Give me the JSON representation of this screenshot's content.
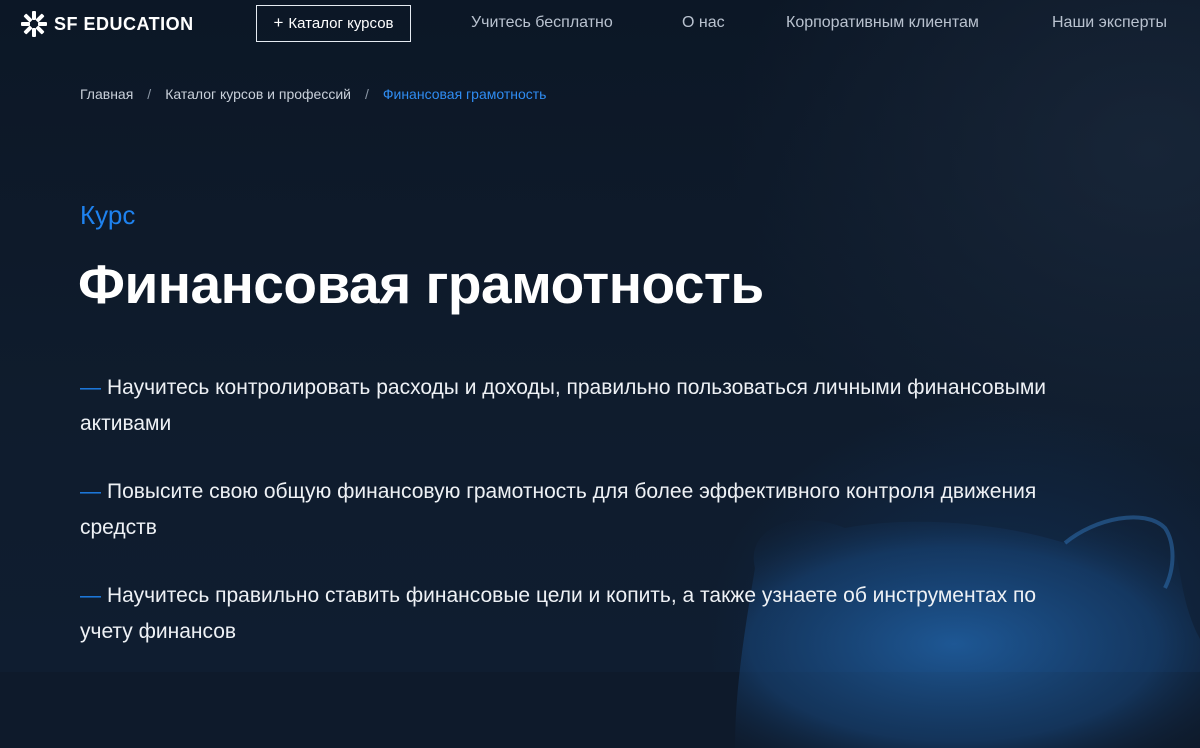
{
  "brand": {
    "name": "SF EDUCATION",
    "logo_icon": "snowflake-icon"
  },
  "header": {
    "catalog_button": "Каталог курсов",
    "nav": [
      "Учитесь бесплатно",
      "О нас",
      "Корпоративным клиентам",
      "Наши эксперты"
    ]
  },
  "breadcrumb": {
    "items": [
      "Главная",
      "Каталог курсов и профессий",
      "Финансовая грамотность"
    ],
    "separator": "/"
  },
  "hero": {
    "kicker": "Курс",
    "title": "Финансовая грамотность",
    "bullet_marker": "—",
    "bullets": [
      "Научитесь контролировать расходы и доходы, правильно пользоваться личными финансовыми активами",
      "Повысите свою общую финансовую грамотность для более эффективного контроля движения средств",
      "Научитесь правильно ставить финансовые цели и копить, а также узнаете об инструментах по учету финансов"
    ]
  },
  "colors": {
    "background": "#0e1a2b",
    "accent": "#1e82ef",
    "text": "#ffffff",
    "nav_text": "#b9c2cf"
  }
}
